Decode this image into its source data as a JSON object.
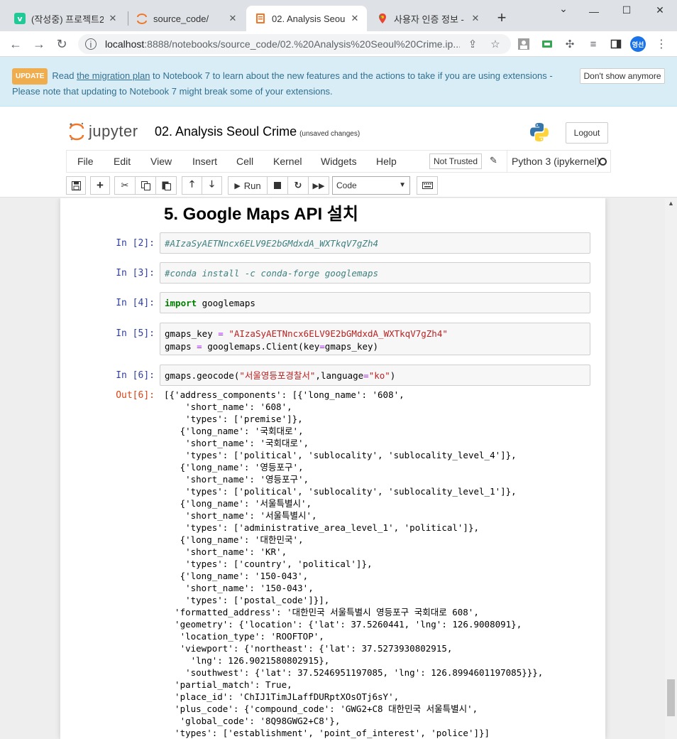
{
  "browser": {
    "tabs": [
      {
        "title": "(작성중) 프로젝트2",
        "favicon": "velog-icon",
        "active": false
      },
      {
        "title": "source_code/",
        "favicon": "jupyter-icon",
        "active": false
      },
      {
        "title": "02. Analysis Seoul",
        "favicon": "notebook-icon",
        "active": true
      },
      {
        "title": "사용자 인증 정보 -",
        "favicon": "google-maps-icon",
        "active": false
      }
    ],
    "url_host": "localhost",
    "url_path": ":8888/notebooks/source_code/02.%20Analysis%20Seoul%20Crime.ip...",
    "profile_initials": "영선"
  },
  "banner": {
    "badge": "UPDATE",
    "text_before": "Read ",
    "link": "the migration plan",
    "text_after": " to Notebook 7 to learn about the new features and the actions to take if you are using extensions - Please note that updating to Notebook 7 might break some of your extensions.",
    "dismiss": "Don't show anymore"
  },
  "header": {
    "logo_text": "jupyter",
    "notebook_title": "02. Analysis Seoul Crime",
    "save_status": "(unsaved changes)",
    "logout": "Logout"
  },
  "menu": {
    "items": [
      "File",
      "Edit",
      "View",
      "Insert",
      "Cell",
      "Kernel",
      "Widgets",
      "Help"
    ],
    "trust": "Not Trusted",
    "kernel": "Python 3 (ipykernel)"
  },
  "toolbar": {
    "run_label": "Run",
    "cell_type": "Code"
  },
  "notebook": {
    "heading": "5. Google Maps API 설치",
    "cells": [
      {
        "prompt": "In [2]:",
        "code": "#AIzaSyAETNncx6ELV9E2bGMdxdA_WXTkqV7gZh4"
      },
      {
        "prompt": "In [3]:",
        "code": "#conda install -c conda-forge googlemaps"
      },
      {
        "prompt": "In [4]:",
        "code": "import googlemaps"
      },
      {
        "prompt": "In [5]:",
        "code": "gmaps_key = \"AIzaSyAETNncx6ELV9E2bGMdxdA_WXTkqV7gZh4\"\ngmaps = googlemaps.Client(key=gmaps_key)"
      },
      {
        "prompt": "In [6]:",
        "code": "gmaps.geocode(\"서울영등포경찰서\",language=\"ko\")"
      }
    ],
    "output_prompt": "Out[6]:",
    "output": "[{'address_components': [{'long_name': '608',\n    'short_name': '608',\n    'types': ['premise']},\n   {'long_name': '국회대로',\n    'short_name': '국회대로',\n    'types': ['political', 'sublocality', 'sublocality_level_4']},\n   {'long_name': '영등포구',\n    'short_name': '영등포구',\n    'types': ['political', 'sublocality', 'sublocality_level_1']},\n   {'long_name': '서울특별시',\n    'short_name': '서울특별시',\n    'types': ['administrative_area_level_1', 'political']},\n   {'long_name': '대한민국',\n    'short_name': 'KR',\n    'types': ['country', 'political']},\n   {'long_name': '150-043',\n    'short_name': '150-043',\n    'types': ['postal_code']}],\n  'formatted_address': '대한민국 서울특별시 영등포구 국회대로 608',\n  'geometry': {'location': {'lat': 37.5260441, 'lng': 126.9008091},\n   'location_type': 'ROOFTOP',\n   'viewport': {'northeast': {'lat': 37.5273930802915,\n     'lng': 126.9021580802915},\n    'southwest': {'lat': 37.5246951197085, 'lng': 126.8994601197085}}},\n  'partial_match': True,\n  'place_id': 'ChIJ1TimJLaffDURptXOsOTj6sY',\n  'plus_code': {'compound_code': 'GWG2+C8 대한민국 서울특별시',\n   'global_code': '8Q98GWG2+C8'},\n  'types': ['establishment', 'point_of_interest', 'police']}]"
  }
}
